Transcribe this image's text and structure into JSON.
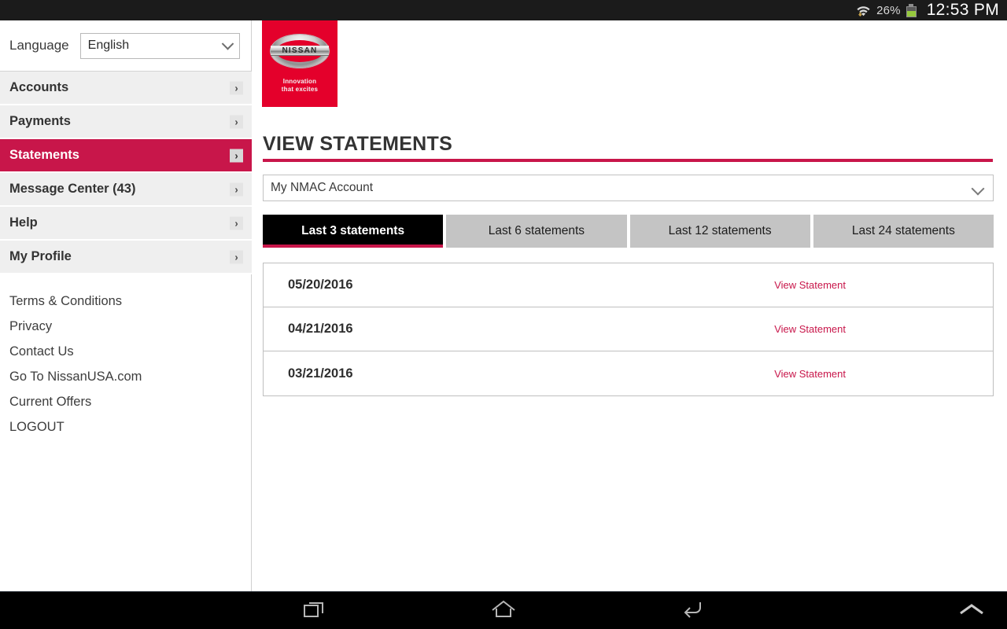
{
  "statusbar": {
    "wifi_icon": "wifi-icon",
    "battery_percent": "26%",
    "battery_icon": "battery-icon",
    "clock": "12:53 PM"
  },
  "sidebar": {
    "language_label": "Language",
    "language_value": "English",
    "language_chevron_icon": "chevron-down-icon",
    "nav_items": [
      {
        "label": "Accounts",
        "active": false,
        "chevron": "›"
      },
      {
        "label": "Payments",
        "active": false,
        "chevron": "›"
      },
      {
        "label": "Statements",
        "active": true,
        "chevron": "›"
      },
      {
        "label": "Message Center (43)",
        "active": false,
        "chevron": "›"
      },
      {
        "label": "Help",
        "active": false,
        "chevron": "›"
      },
      {
        "label": "My Profile",
        "active": false,
        "chevron": "›"
      }
    ],
    "footer_links": [
      "Terms & Conditions",
      "Privacy",
      "Contact Us",
      "Go To NissanUSA.com",
      "Current Offers",
      "LOGOUT"
    ]
  },
  "brand": {
    "name": "NISSAN",
    "tagline_line1": "Innovation",
    "tagline_line2": "that excites",
    "bg_color": "#e4002b"
  },
  "main": {
    "page_title": "VIEW STATEMENTS",
    "account_select_value": "My NMAC Account",
    "account_select_chevron_icon": "chevron-down-icon",
    "tabs": [
      {
        "label": "Last 3 statements",
        "active": true
      },
      {
        "label": "Last 6 statements",
        "active": false
      },
      {
        "label": "Last 12 statements",
        "active": false
      },
      {
        "label": "Last 24 statements",
        "active": false
      }
    ],
    "statements": [
      {
        "date": "05/20/2016",
        "link": "View Statement"
      },
      {
        "date": "04/21/2016",
        "link": "View Statement"
      },
      {
        "date": "03/21/2016",
        "link": "View Statement"
      }
    ]
  },
  "navbar": {
    "recents_icon": "recents-icon",
    "home_icon": "home-icon",
    "back_icon": "back-icon",
    "up_icon": "chevron-up-icon"
  },
  "colors": {
    "accent_crimson": "#c8164a",
    "brand_red": "#e4002b",
    "nav_item_bg": "#efefef",
    "tab_inactive_bg": "#c4c4c4"
  }
}
